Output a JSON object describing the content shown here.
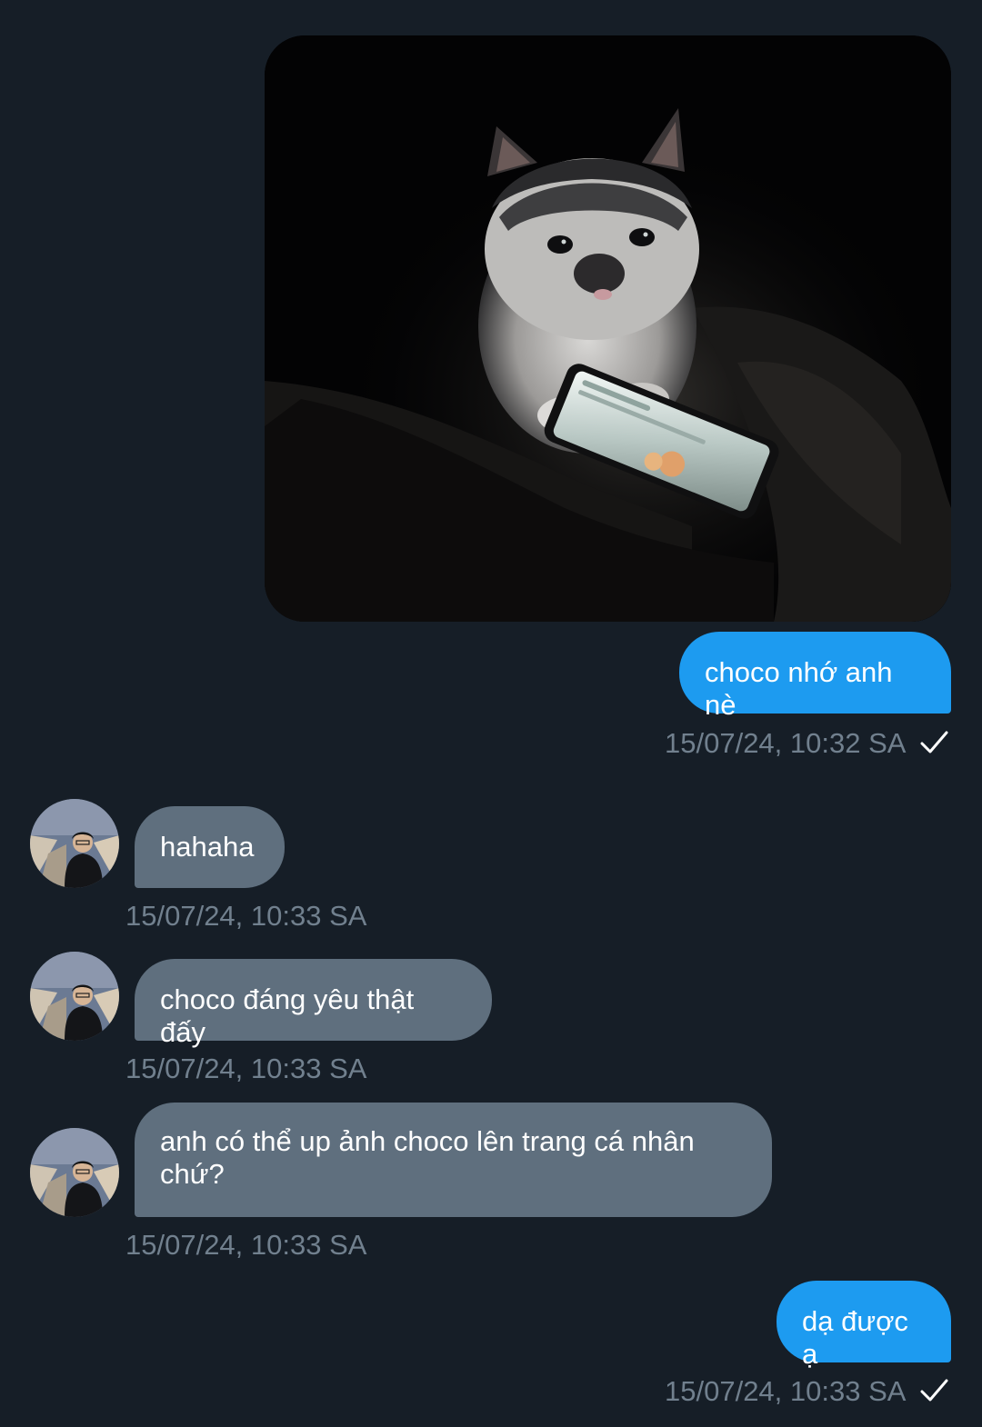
{
  "messages": [
    {
      "id": "m1",
      "direction": "outgoing",
      "kind": "image",
      "image_icon": "cat-with-phone-photo"
    },
    {
      "id": "m2",
      "direction": "outgoing",
      "text": "choco nhớ anh nè",
      "timestamp": "15/07/24, 10:32 SA",
      "status_icon": "checkmark-icon"
    },
    {
      "id": "m3",
      "direction": "incoming",
      "text": "hahaha",
      "timestamp": "15/07/24, 10:33 SA"
    },
    {
      "id": "m4",
      "direction": "incoming",
      "text": "choco đáng yêu thật đấy",
      "timestamp": "15/07/24, 10:33 SA"
    },
    {
      "id": "m5",
      "direction": "incoming",
      "text": "anh có thể up ảnh choco lên trang cá nhân chứ?",
      "timestamp": "15/07/24, 10:33 SA"
    },
    {
      "id": "m6",
      "direction": "outgoing",
      "text": "dạ được ạ",
      "timestamp": "15/07/24, 10:33 SA",
      "status_icon": "checkmark-icon"
    }
  ],
  "colors": {
    "background": "#161e27",
    "outgoing_bubble": "#1d9bf0",
    "incoming_bubble": "#5f6f7e",
    "timestamp": "#71808e"
  }
}
